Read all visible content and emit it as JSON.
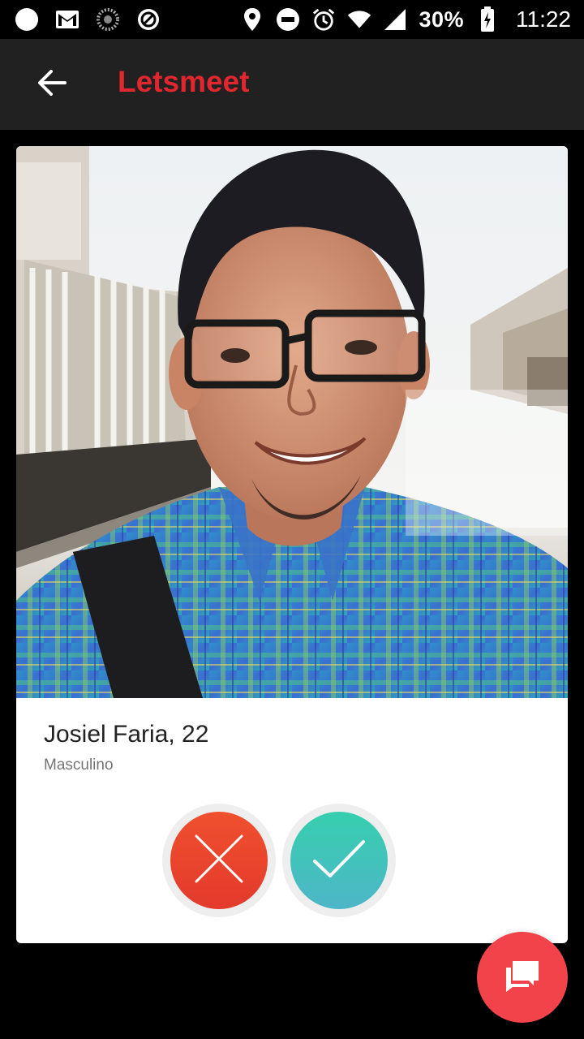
{
  "status_bar": {
    "battery": "30%",
    "time": "11:22",
    "icons": [
      "circle-icon",
      "gmail-icon",
      "sync-icon",
      "blocked-icon",
      "location-icon",
      "do-not-disturb-icon",
      "alarm-icon",
      "wifi-icon",
      "signal-icon",
      "battery-charging-icon"
    ]
  },
  "app_bar": {
    "title": "Letsmeet",
    "title_color": "#e0262f",
    "back_icon": "arrow-back-icon"
  },
  "profile": {
    "name_age": "Josiel Faria, 22",
    "gender": "Masculino",
    "photo_icon": "profile-photo"
  },
  "actions": {
    "dislike_icon": "close-icon",
    "dislike_color": "#e8432d",
    "like_icon": "check-icon",
    "like_color": "#3ec4b6"
  },
  "fab": {
    "icon": "chat-icon",
    "color": "#f2434a"
  }
}
